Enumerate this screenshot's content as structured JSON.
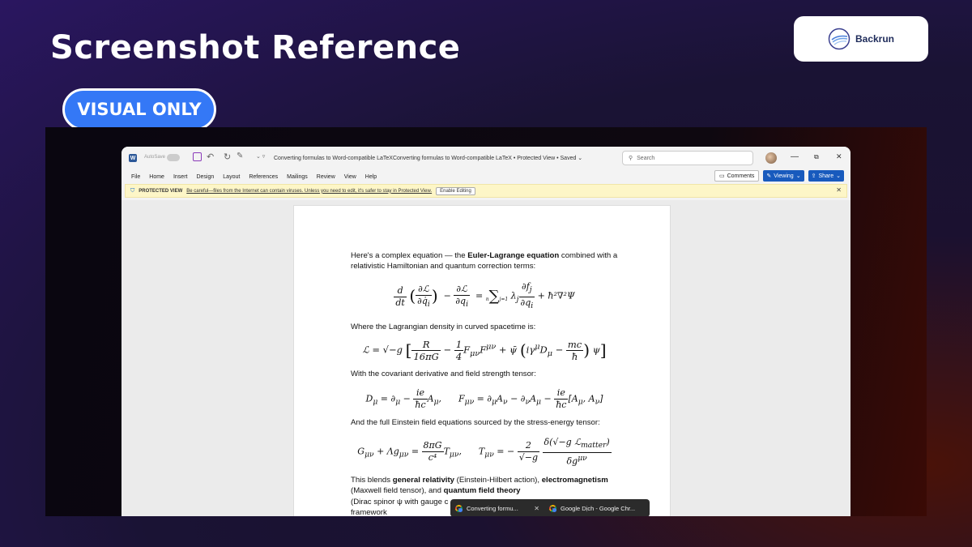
{
  "banner": {
    "title": "Screenshot Reference",
    "pill": "VISUAL ONLY",
    "brand": "Backrun"
  },
  "word": {
    "autosave_label": "AutoSave",
    "autosave_state": "Off",
    "doc_title": "Converting formulas to Word-compatible LaTeXConverting formulas to Word-compatible LaTeX  •  Protected View  •  Saved ⌄",
    "search_placeholder": "Search",
    "menu": [
      "File",
      "Home",
      "Insert",
      "Design",
      "Layout",
      "References",
      "Mailings",
      "Review",
      "View",
      "Help"
    ],
    "comments_label": "Comments",
    "viewing_label": "Viewing",
    "share_label": "Share",
    "protected": {
      "label": "PROTECTED VIEW",
      "message": "Be careful—files from the Internet can contain viruses. Unless you need to edit, it's safer to stay in Protected View.",
      "button": "Enable Editing"
    }
  },
  "document": {
    "p1_a": "Here's a complex equation — the ",
    "p1_b": "Euler-Lagrange equation",
    "p1_c": " combined with a relativistic Hamiltonian and quantum correction terms:",
    "p2": "Where the Lagrangian density in curved spacetime is:",
    "p3": "With the covariant derivative and field strength tensor:",
    "p4": "And the full Einstein field equations sourced by the stress-energy tensor:",
    "p5_a": "This blends ",
    "p5_b": "general relativity",
    "p5_c": " (Einstein-Hilbert action), ",
    "p5_d": "electromagnetism",
    "p5_e": " (Maxwell field tensor), and ",
    "p5_f": "quantum field theory",
    "p5_g": " (Dirac spinor ψ with gauge c",
    "p5_h": "framework"
  },
  "taskbar": {
    "items": [
      "Converting formu...",
      "Google Dịch - Google Chr..."
    ]
  }
}
